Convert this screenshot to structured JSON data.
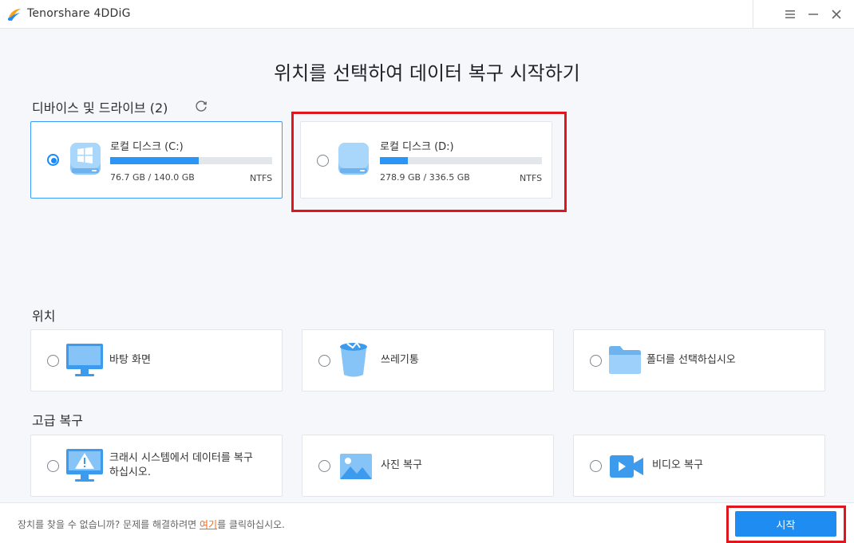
{
  "app": {
    "title": "Tenorshare 4DDiG"
  },
  "heading": "위치를 선택하여 데이터 복구 시작하기",
  "devices": {
    "label": "디바이스 및 드라이브 (2)",
    "drives": [
      {
        "name": "로컬 디스크 (C:)",
        "size": "76.7 GB / 140.0 GB",
        "fs": "NTFS",
        "used_fraction": 0.548,
        "selected": true
      },
      {
        "name": "로컬 디스크 (D:)",
        "size": "278.9 GB / 336.5 GB",
        "fs": "NTFS",
        "used_fraction": 0.17,
        "selected": false
      }
    ]
  },
  "location": {
    "label": "위치",
    "items": [
      {
        "label": "바탕 화면",
        "icon": "desktop-monitor-icon"
      },
      {
        "label": "쓰레기통",
        "icon": "recycle-bin-icon"
      },
      {
        "label": "폴더를 선택하십시오",
        "icon": "folder-icon"
      }
    ]
  },
  "advanced": {
    "label": "고급 복구",
    "items": [
      {
        "label_line1": "크래시 시스템에서 데이터를 복구",
        "label_line2": "하십시오.",
        "icon": "crash-warning-monitor-icon"
      },
      {
        "label": "사진 복구",
        "icon": "photo-icon"
      },
      {
        "label": "비디오 복구",
        "icon": "video-camera-icon"
      }
    ]
  },
  "footer": {
    "text_before": "장치를 찾을 수 없습니까? 문제를 해결하려면 ",
    "link": "여기",
    "text_after": "를 클릭하십시오.",
    "start_button": "시작"
  },
  "colors": {
    "accent": "#1e8cf0",
    "highlight": "#e0161e",
    "link": "#f26b1d"
  }
}
